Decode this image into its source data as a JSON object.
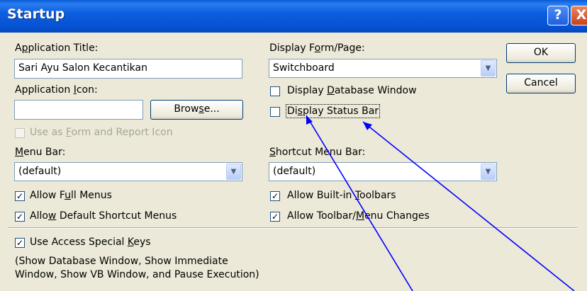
{
  "window": {
    "title": "Startup",
    "help_glyph": "?",
    "close_glyph": "X"
  },
  "app_title": {
    "label_pre": "A",
    "label_u": "p",
    "label_post": "plication Title:",
    "value": "Sari Ayu Salon Kecantikan"
  },
  "app_icon": {
    "label_pre": "Application ",
    "label_u": "I",
    "label_post": "con:",
    "value": "",
    "browse_pre": "Brow",
    "browse_u": "s",
    "browse_post": "e..."
  },
  "use_as_icon": {
    "label_pre": "Use as ",
    "label_u": "F",
    "label_post": "orm and Report Icon",
    "checked": false,
    "disabled": true
  },
  "menu_bar": {
    "label_pre": "",
    "label_u": "M",
    "label_post": "enu Bar:",
    "value": "(default)"
  },
  "allow_full_menus": {
    "label_pre": "Allow F",
    "label_u": "u",
    "label_post": "ll Menus",
    "checked": true
  },
  "allow_default_shortcut": {
    "label_pre": "Allo",
    "label_u": "w",
    "label_post": " Default Shortcut Menus",
    "checked": true
  },
  "display_form": {
    "label_pre": "Display F",
    "label_u": "o",
    "label_post": "rm/Page:",
    "value": "Switchboard"
  },
  "display_db_window": {
    "label_pre": "Display ",
    "label_u": "D",
    "label_post": "atabase Window",
    "checked": false
  },
  "display_status_bar": {
    "label_pre": "Di",
    "label_u": "s",
    "label_post": "play Status Bar",
    "checked": false
  },
  "shortcut_menu_bar": {
    "label_pre": "",
    "label_u": "S",
    "label_post": "hortcut Menu Bar:",
    "value": "(default)"
  },
  "allow_builtin_toolbars": {
    "label_pre": "Allow Built-in ",
    "label_u": "T",
    "label_post": "oolbars",
    "checked": true
  },
  "allow_toolbar_changes": {
    "label_pre": "Allow Toolbar/",
    "label_u": "M",
    "label_post": "enu Changes",
    "checked": true
  },
  "use_special_keys": {
    "label_pre": "Use Access Special ",
    "label_u": "K",
    "label_post": "eys",
    "checked": true
  },
  "special_keys_note_1": "(Show Database Window, Show Immediate",
  "special_keys_note_2": "Window, Show VB Window, and Pause Execution)",
  "buttons": {
    "ok": "OK",
    "cancel": "Cancel"
  },
  "check_glyph": "✓",
  "dropdown_glyph": "▼",
  "colors": {
    "titlebar": "#0a5bd6",
    "dialog_bg": "#ece9d8",
    "annotation_line": "#0000ff"
  }
}
